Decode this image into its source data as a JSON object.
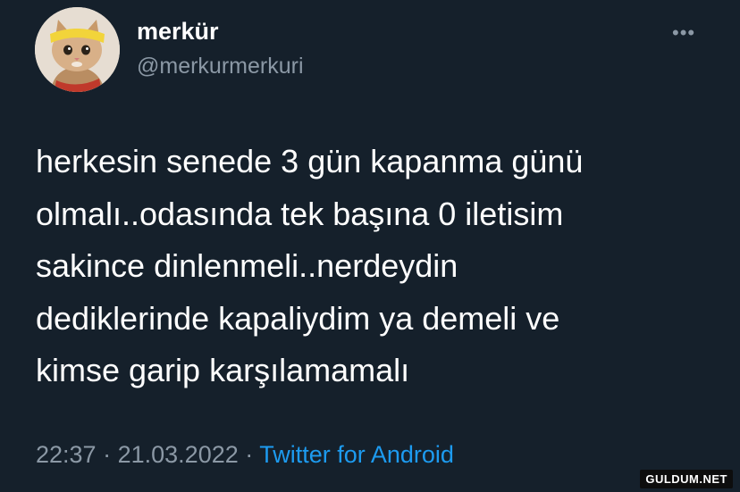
{
  "user": {
    "display_name": "merkür",
    "handle": "@merkurmerkuri"
  },
  "more_icon": "more-horizontal-icon",
  "tweet": {
    "lines": [
      "herkesin senede 3 gün kapanma günü",
      "olmalı..odasında tek başına 0 iletisim",
      "sakince dinlenmeli..nerdeydin",
      "dediklerinde kapaliydim ya demeli ve",
      "kimse garip karşılamamalı"
    ],
    "time": "22:37",
    "separator": "·",
    "date": "21.03.2022",
    "source": "Twitter for Android"
  },
  "watermark": "GULDUM.NET",
  "colors": {
    "background": "#15202b",
    "text": "#ffffff",
    "muted": "#8b98a5",
    "link": "#1d9bf0"
  }
}
